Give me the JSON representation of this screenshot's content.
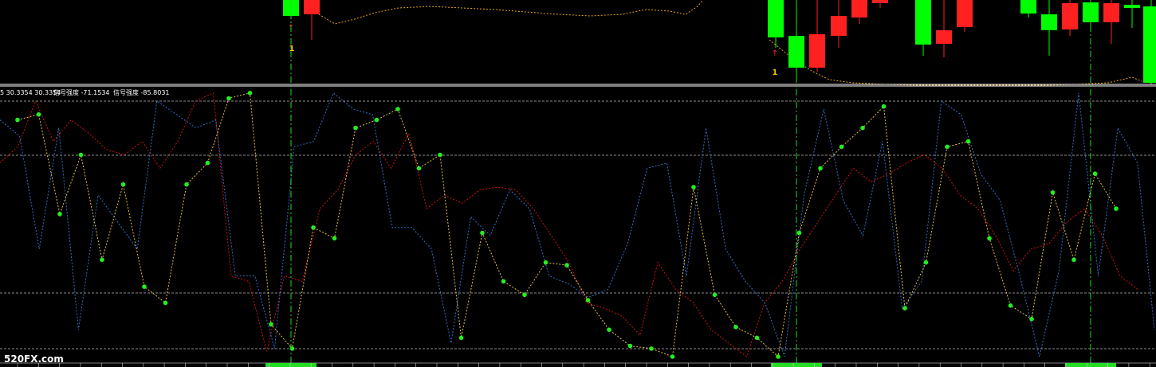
{
  "indicator_header": {
    "values_text": "5 30.3354 30.3354",
    "signal_label_1": "信号强度 -71.1534",
    "signal_label_2": "信号强度 -85.8031"
  },
  "watermark": "520FX.com",
  "signal_markers": [
    {
      "label": "1",
      "color": "#ff2a2a"
    },
    {
      "label": "1",
      "color": "#ff2a2a"
    }
  ],
  "colors": {
    "background": "#000000",
    "bull_candle": "#00ff00",
    "bear_candle": "#ff2020",
    "red_line": "#d01010",
    "blue_line": "#2f6fc8",
    "yellow_line": "#e8c040",
    "signal_dot": "#22ee22",
    "green_dash": "#22dd22",
    "separator": "#ffffff",
    "level_line": "#bbbbbb"
  },
  "chart_data": {
    "type": "line",
    "series": [
      {
        "values": [
          0.72,
          0.78,
          0.95,
          0.8,
          0.88,
          0.83,
          0.77,
          0.75,
          0.8,
          0.7,
          0.8,
          0.95,
          0.98,
          0.3,
          0.28,
          0.02,
          0.3,
          0.28,
          0.55,
          0.62,
          0.75,
          0.8,
          0.7,
          0.83,
          0.55,
          0.6,
          0.57,
          0.62,
          0.63,
          0.62,
          0.55,
          0.45,
          0.35,
          0.2,
          0.18,
          0.15,
          0.08,
          0.35,
          0.25,
          0.2,
          0.1,
          0.05,
          0.0,
          0.2,
          0.28,
          0.4,
          0.5,
          0.6,
          0.7,
          0.65,
          0.68,
          0.72,
          0.75,
          0.7,
          0.6,
          0.55,
          0.45,
          0.32,
          0.4,
          0.42,
          0.5,
          0.55,
          0.45,
          0.3,
          0.25
        ]
      },
      {
        "values": [
          0.88,
          0.82,
          0.4,
          0.85,
          0.1,
          0.6,
          0.5,
          0.4,
          0.95,
          0.9,
          0.85,
          0.88,
          0.3,
          0.3,
          0.03,
          0.78,
          0.8,
          0.98,
          0.92,
          0.9,
          0.48,
          0.48,
          0.4,
          0.05,
          0.52,
          0.45,
          0.62,
          0.55,
          0.3,
          0.27,
          0.22,
          0.25,
          0.42,
          0.7,
          0.72,
          0.3,
          0.85,
          0.4,
          0.28,
          0.2,
          0.0,
          0.6,
          0.92,
          0.58,
          0.45,
          0.8,
          0.18,
          0.28,
          0.95,
          0.9,
          0.68,
          0.58,
          0.3,
          0.0,
          0.32,
          0.98,
          0.3,
          0.85,
          0.72,
          0.1
        ]
      },
      {
        "values": [
          0.88,
          0.9,
          0.53,
          0.75,
          0.36,
          0.64,
          0.26,
          0.2,
          0.64,
          0.72,
          0.96,
          0.98,
          0.12,
          0.03,
          0.48,
          0.44,
          0.85,
          0.88,
          0.92,
          0.7,
          0.75,
          0.07,
          0.46,
          0.28,
          0.23,
          0.35,
          0.34,
          0.21,
          0.1,
          0.04,
          0.03,
          0.0,
          0.63,
          0.23,
          0.11,
          0.07,
          0.0,
          0.46,
          0.7,
          0.78,
          0.85,
          0.93,
          0.18,
          0.35,
          0.78,
          0.8,
          0.44,
          0.19,
          0.14,
          0.61,
          0.36,
          0.68,
          0.55
        ]
      }
    ]
  }
}
